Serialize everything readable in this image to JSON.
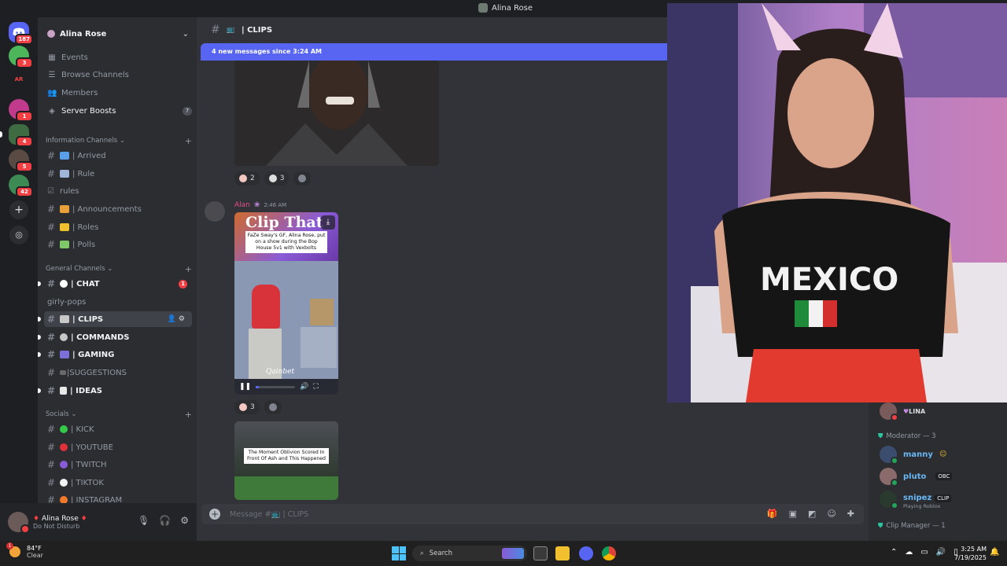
{
  "window": {
    "title": "Alina Rose"
  },
  "rail": {
    "badges": [
      "187",
      "3",
      "1",
      "4",
      "5",
      "42"
    ],
    "labels": [
      "AR"
    ]
  },
  "server": {
    "name": "Alina Rose",
    "top_items": [
      {
        "icon": "calendar-icon",
        "label": "Events"
      },
      {
        "icon": "browse-icon",
        "label": "Browse Channels"
      },
      {
        "icon": "members-icon",
        "label": "Members"
      },
      {
        "icon": "boost-icon",
        "label": "Server Boosts",
        "count": "7"
      }
    ],
    "categories": [
      {
        "name": "Information Channels",
        "channels": [
          {
            "name": "| Arrived",
            "emoji_color": "#5aa0e8",
            "state": "normal"
          },
          {
            "name": "| Rule",
            "emoji_color": "#9fb6d9",
            "state": "normal"
          },
          {
            "name": "rules",
            "emoji_color": "",
            "state": "normal"
          },
          {
            "name": "| Announcements",
            "emoji_color": "#e8a13a",
            "state": "normal"
          },
          {
            "name": "| Roles",
            "emoji_color": "#f0c02e",
            "state": "normal"
          },
          {
            "name": "| Polls",
            "emoji_color": "#7ec86a",
            "state": "normal"
          }
        ]
      },
      {
        "name": "General Channels",
        "channels": [
          {
            "name": "| CHAT",
            "emoji_color": "#ffffff",
            "state": "unread",
            "mention": "1"
          },
          {
            "name": "girly-pops",
            "emoji_color": "",
            "state": "normal"
          },
          {
            "name": "| CLIPS",
            "emoji_color": "#c7c7c7",
            "state": "active"
          },
          {
            "name": "| COMMANDS",
            "emoji_color": "#c7c7c7",
            "state": "unread"
          },
          {
            "name": "| GAMING",
            "emoji_color": "#7c6fd8",
            "state": "unread"
          },
          {
            "name": "|SUGGESTIONS",
            "emoji_color": "#6a6a6a",
            "state": "normal"
          },
          {
            "name": "| IDEAS",
            "emoji_color": "#e8e8e8",
            "state": "unread"
          }
        ]
      },
      {
        "name": "Socials",
        "channels": [
          {
            "name": "| KICK",
            "emoji_color": "#35c94a",
            "state": "normal"
          },
          {
            "name": "| YOUTUBE",
            "emoji_color": "#e0303a",
            "state": "normal"
          },
          {
            "name": "| TWITCH",
            "emoji_color": "#8a5bd6",
            "state": "normal"
          },
          {
            "name": "| TIKTOK",
            "emoji_color": "#f2f2f2",
            "state": "normal"
          },
          {
            "name": "| INSTAGRAM",
            "emoji_color": "#f07a2a",
            "state": "normal"
          }
        ]
      }
    ]
  },
  "user_panel": {
    "name": "Alina Rose",
    "status": "Do Not Disturb"
  },
  "chat": {
    "channel": "| CLIPS",
    "new_messages": "4 new messages since 3:24 AM",
    "first_reactions": [
      {
        "color": "#f4c7c3",
        "count": "2"
      },
      {
        "color": "#dddddd",
        "count": "3"
      }
    ],
    "message": {
      "author": "Alan",
      "time": "2:46 AM",
      "clip_caption": "FaZe Sway's GF, Alina Rose, put on a show during the Bop House 5v1 with Vexbolts",
      "clip_watermark": "Clip That",
      "clip_footer": "Qainbet",
      "reactions": [
        {
          "color": "#f4c7c3",
          "count": "3"
        }
      ]
    },
    "second_clip_caption": "The Moment Oblivion Scored In Front Of Ash and This Happened",
    "composer_placeholder": "Message #📺 | CLIPS"
  },
  "members": {
    "top_member": "LINA",
    "groups": [
      {
        "title": "Moderator — 3",
        "members": [
          {
            "name": "manny",
            "color": "#6ab7f5",
            "tag": "",
            "sub": ""
          },
          {
            "name": "pluto",
            "color": "#6ab7f5",
            "tag": "OBC",
            "sub": ""
          },
          {
            "name": "snipez",
            "color": "#6ab7f5",
            "tag": "CLIP",
            "sub": "Playing Roblox"
          }
        ]
      },
      {
        "title": "Clip Manager — 1",
        "members": []
      }
    ]
  },
  "webcam": {
    "shirt_text": "MEXICO"
  },
  "taskbar": {
    "weather_temp": "84°F",
    "weather_cond": "Clear",
    "weather_badge": "1",
    "search_placeholder": "Search",
    "time": "3:25 AM",
    "date": "7/19/2025"
  }
}
